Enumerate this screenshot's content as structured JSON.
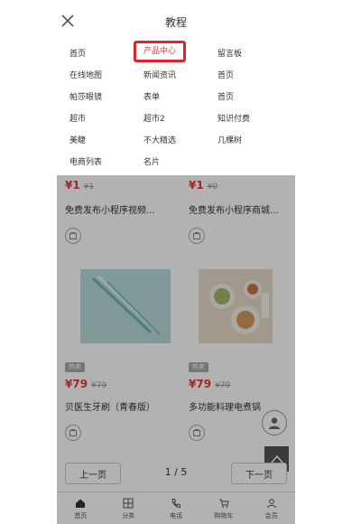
{
  "menu": {
    "title": "教程",
    "items": [
      {
        "label": "首页"
      },
      {
        "label": "产品中心",
        "active": true
      },
      {
        "label": "留言板"
      },
      {
        "label": "在线地图"
      },
      {
        "label": "新闻资讯"
      },
      {
        "label": "首页"
      },
      {
        "label": "帕莎眼镜"
      },
      {
        "label": "表单"
      },
      {
        "label": "首页"
      },
      {
        "label": "超市"
      },
      {
        "label": "超市2"
      },
      {
        "label": "知识付费"
      },
      {
        "label": "美睫"
      },
      {
        "label": "不大精选"
      },
      {
        "label": "几棵树"
      },
      {
        "label": "电商列表"
      },
      {
        "label": "名片"
      }
    ]
  },
  "products": [
    {
      "price": "¥1",
      "old_price": "¥1",
      "title": "免费发布小程序视频..."
    },
    {
      "price": "¥1",
      "old_price": "¥0",
      "title": "免费发布小程序商城..."
    },
    {
      "tag": "热卖",
      "price": "¥79",
      "old_price": "¥79",
      "title": "贝医生牙刷（青春版）"
    },
    {
      "tag": "热卖",
      "price": "¥79",
      "old_price": "¥79",
      "title": "多功能料理电煮锅"
    }
  ],
  "pager": {
    "prev": "上一页",
    "status": "1 / 5",
    "next": "下一页"
  },
  "tabbar": {
    "items": [
      {
        "label": "首页",
        "icon": "home-icon"
      },
      {
        "label": "分类",
        "icon": "grid-icon"
      },
      {
        "label": "电话",
        "icon": "phone-icon"
      },
      {
        "label": "购物车",
        "icon": "cart-icon"
      },
      {
        "label": "会员",
        "icon": "user-icon"
      }
    ]
  },
  "colors": {
    "accent": "#e0232b",
    "price": "#e4393c",
    "overlay": "rgba(0,0,0,0.3)"
  }
}
